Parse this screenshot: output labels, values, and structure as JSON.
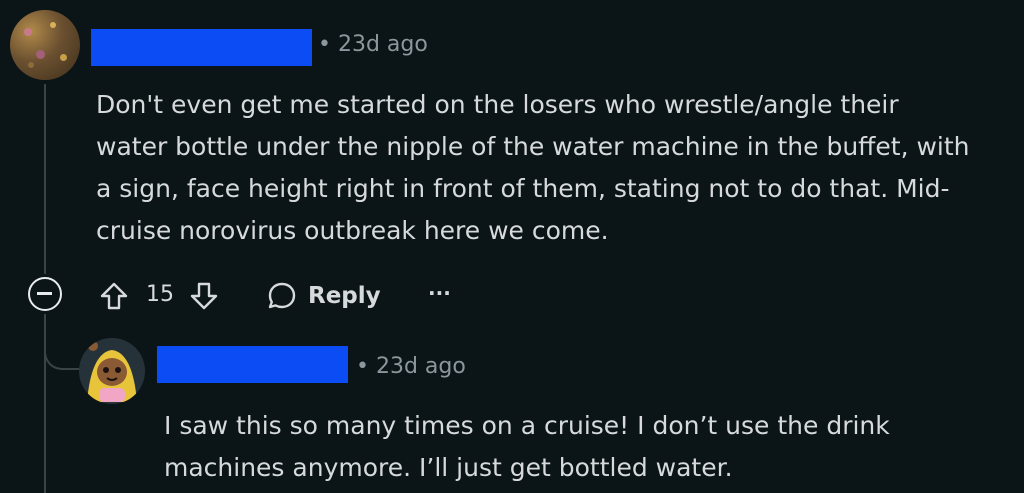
{
  "comment": {
    "timestamp": "• 23d ago",
    "body_lines": [
      "Don't even get me started on the losers who wrestle/angle their",
      "water bottle under the nipple of the water machine in the buffet, with",
      "a sign, face height right in front of them, stating not to do that. Mid-",
      "cruise norovirus outbreak here we come."
    ],
    "vote_count": "15",
    "reply_label": "Reply",
    "more_label": "···"
  },
  "reply": {
    "timestamp": "• 23d ago",
    "body_lines": [
      "I saw this so many times on a cruise! I don’t use the drink",
      "machines anymore. I’ll just get bottled water."
    ]
  },
  "colors": {
    "background": "#0b1416",
    "redaction": "#0c4cf4",
    "text": "#d7dadc",
    "meta": "#8a979d"
  }
}
